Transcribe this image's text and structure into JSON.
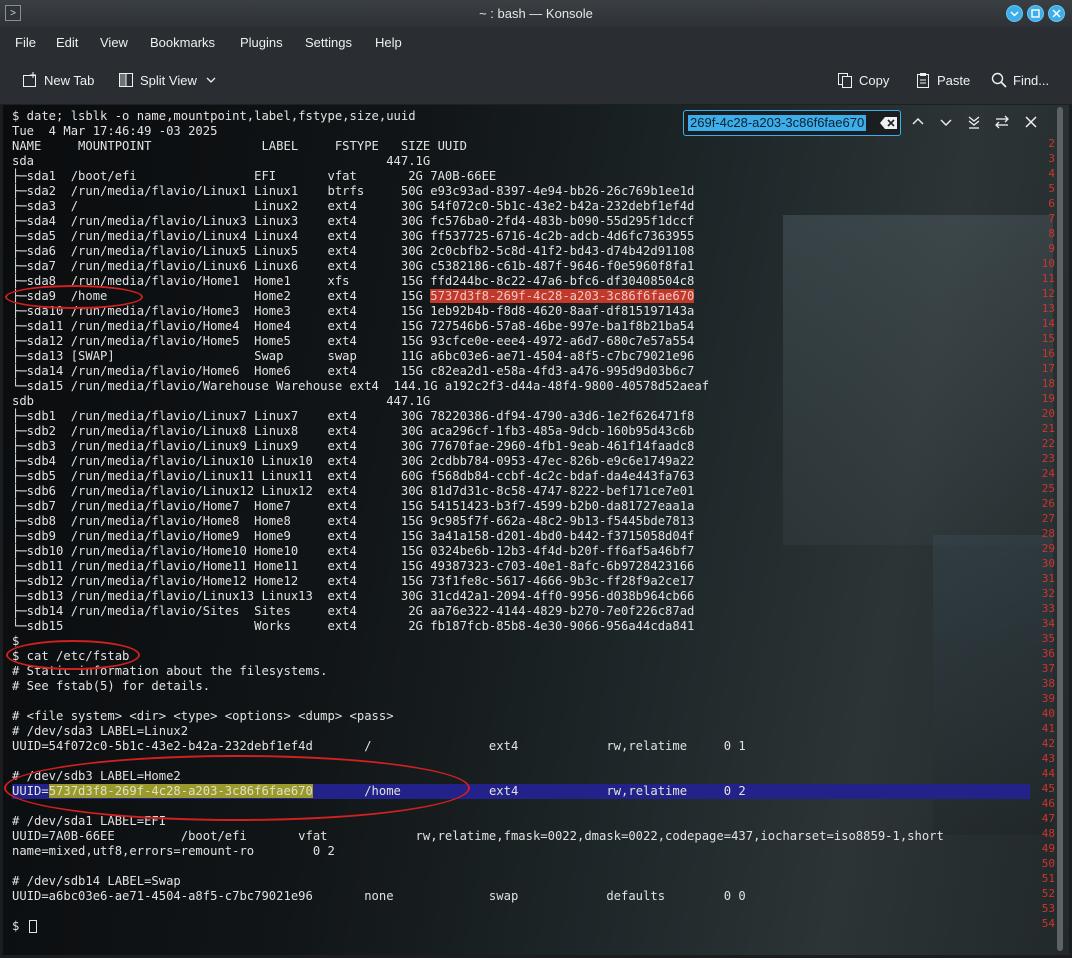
{
  "window": {
    "title": "~ : bash — Konsole",
    "app_icon": ">"
  },
  "menu": [
    "File",
    "Edit",
    "View",
    "Bookmarks",
    "Plugins",
    "Settings",
    "Help"
  ],
  "toolbar": {
    "new_tab": "New Tab",
    "split_view": "Split View",
    "copy": "Copy",
    "paste": "Paste",
    "find": "Find..."
  },
  "search": {
    "value": "269f-4c28-a203-3c86f6fae670"
  },
  "terminal": {
    "lines": [
      "$ date; lsblk -o name,mountpoint,label,fstype,size,uuid",
      "Tue  4 Mar 17:46:49 -03 2025",
      "NAME     MOUNTPOINT               LABEL     FSTYPE   SIZE UUID",
      "sda                                                447.1G",
      "├─sda1  /boot/efi                EFI       vfat       2G 7A0B-66EE",
      "├─sda2  /run/media/flavio/Linux1 Linux1    btrfs     50G e93c93ad-8397-4e94-bb26-26c769b1ee1d",
      "├─sda3  /                        Linux2    ext4      30G 54f072c0-5b1c-43e2-b42a-232debf1ef4d",
      "├─sda4  /run/media/flavio/Linux3 Linux3    ext4      30G fc576ba0-2fd4-483b-b090-55d295f1dccf",
      "├─sda5  /run/media/flavio/Linux4 Linux4    ext4      30G ff537725-6716-4c2b-adcb-4d6fc7363955",
      "├─sda6  /run/media/flavio/Linux5 Linux5    ext4      30G 2c0cbfb2-5c8d-41f2-bd43-d74b42d91108",
      "├─sda7  /run/media/flavio/Linux6 Linux6    ext4      30G c5382186-c61b-487f-9646-f0e5960f8fa1",
      "├─sda8  /run/media/flavio/Home1  Home1     xfs       15G ffd244bc-8c22-47a6-bfc6-df30408504c8",
      "├─sda9  /home                    Home2     ext4      15G ",
      "├─sda10 /run/media/flavio/Home3  Home3     ext4      15G 1eb92b4b-f8d8-4620-8aaf-df815197143a",
      "├─sda11 /run/media/flavio/Home4  Home4     ext4      15G 727546b6-57a8-46be-997e-ba1f8b21ba54",
      "├─sda12 /run/media/flavio/Home5  Home5     ext4      15G 93cfce0e-eee4-4972-a6d7-680c7e57a554",
      "├─sda13 [SWAP]                   Swap      swap      11G a6bc03e6-ae71-4504-a8f5-c7bc79021e96",
      "├─sda14 /run/media/flavio/Home6  Home6     ext4      15G c82ea2d1-e58a-4fd3-a476-995d9d03b6c7",
      "└─sda15 /run/media/flavio/Warehouse Warehouse ext4  144.1G a192c2f3-d44a-48f4-9800-40578d52aeaf",
      "sdb                                                447.1G",
      "├─sdb1  /run/media/flavio/Linux7 Linux7    ext4      30G 78220386-df94-4790-a3d6-1e2f626471f8",
      "├─sdb2  /run/media/flavio/Linux8 Linux8    ext4      30G aca296cf-1fb3-485a-9dcb-160b95d43c6b",
      "├─sdb3  /run/media/flavio/Linux9 Linux9    ext4      30G 77670fae-2960-4fb1-9eab-461f14faadc8",
      "├─sdb4  /run/media/flavio/Linux10 Linux10  ext4      30G 2cdbb784-0953-47ec-826b-e9c6e1749a22",
      "├─sdb5  /run/media/flavio/Linux11 Linux11  ext4      60G f568db84-ccbf-4c2c-bdaf-da4e443fa763",
      "├─sdb6  /run/media/flavio/Linux12 Linux12  ext4      30G 81d7d31c-8c58-4747-8222-bef171ce7e01",
      "├─sdb7  /run/media/flavio/Home7  Home7     ext4      15G 54151423-b3f7-4599-b2b0-da81727eaa1a",
      "├─sdb8  /run/media/flavio/Home8  Home8     ext4      15G 9c985f7f-662a-48c2-9b13-f5445bde7813",
      "├─sdb9  /run/media/flavio/Home9  Home9     ext4      15G 3a41a158-d201-4bd0-b442-f3715058d04f",
      "├─sdb10 /run/media/flavio/Home10 Home10    ext4      15G 0324be6b-12b3-4f4d-b20f-ff6af5a46bf7",
      "├─sdb11 /run/media/flavio/Home11 Home11    ext4      15G 49387323-c703-40e1-8afc-6b9728423166",
      "├─sdb12 /run/media/flavio/Home12 Home12    ext4      15G 73f1fe8c-5617-4666-9b3c-ff28f9a2ce17",
      "├─sdb13 /run/media/flavio/Linux13 Linux13  ext4      30G 31cd42a1-2094-4ff0-9956-d038b964cb66",
      "├─sdb14 /run/media/flavio/Sites  Sites     ext4       2G aa76e322-4144-4829-b270-7e0f226c87ad",
      "└─sdb15                          Works     ext4       2G fb187fcb-85b8-4e30-9066-956a44cda841",
      "$",
      "$ cat /etc/fstab",
      "# Static information about the filesystems.",
      "# See fstab(5) for details.",
      "",
      "# <file system> <dir> <type> <options> <dump> <pass>",
      "# /dev/sda3 LABEL=Linux2",
      "UUID=54f072c0-5b1c-43e2-b42a-232debf1ef4d       /                ext4            rw,relatime     0 1",
      "",
      "# /dev/sdb3 LABEL=Home2",
      "UUID=",
      "",
      "# /dev/sda1 LABEL=EFI",
      "UUID=7A0B-66EE         /boot/efi       vfat            rw,relatime,fmask=0022,dmask=0022,codepage=437,iocharset=iso8859-1,short",
      "name=mixed,utf8,errors=remount-ro        0 2",
      "",
      "# /dev/sdb14 LABEL=Swap",
      "UUID=a6bc03e6-ae71-4504-a8f5-c7bc79021e96       none             swap            defaults        0 0",
      "",
      "$ "
    ],
    "highlight_uuid": "5737d3f8-269f-4c28-a203-3c86f6fae670",
    "home_line_rest": "       /home            ext4            rw,relatime     0 2",
    "line_numbers": [
      "2",
      "3",
      "4",
      "5",
      "6",
      "7",
      "8",
      "9",
      "10",
      "11",
      "12",
      "13",
      "14",
      "15",
      "16",
      "17",
      "18",
      "19",
      "20",
      "21",
      "22",
      "23",
      "24",
      "25",
      "26",
      "27",
      "28",
      "29",
      "30",
      "31",
      "32",
      "33",
      "34",
      "35",
      "36",
      "37",
      "38",
      "39",
      "40",
      "41",
      "42",
      "43",
      "44",
      "45",
      "46",
      "47",
      "48",
      "49",
      "50",
      "51",
      "52",
      "53",
      "54"
    ]
  },
  "colors": {
    "accent": "#3daee9",
    "annotation_red": "#d02020",
    "match_red": "#c0392b",
    "match_yellow": "#9a9a2c",
    "selection_blue": "#22228a"
  }
}
